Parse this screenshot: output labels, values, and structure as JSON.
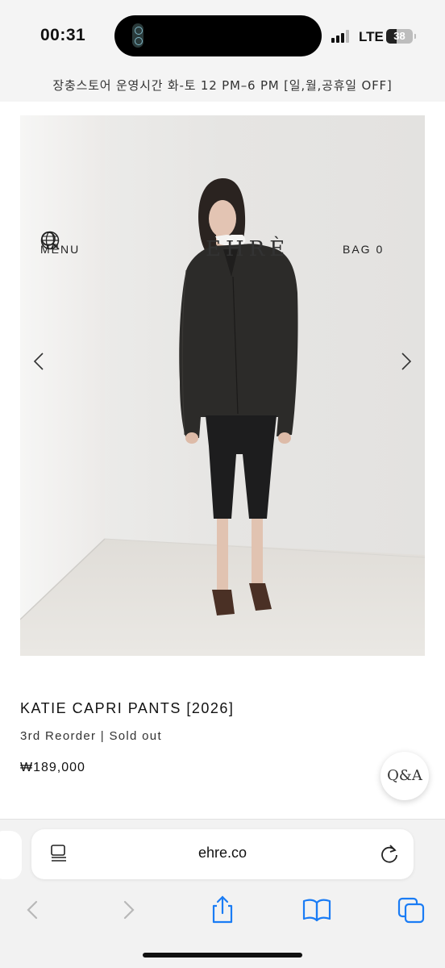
{
  "status_bar": {
    "time": "00:31",
    "network": "LTE",
    "battery": "38",
    "battery_level": 0.38,
    "signal_bars": 3
  },
  "announcement": "장충스토어 운영시간 화-토 12 PM–6 PM [일,월,공휴일 OFF]",
  "header": {
    "menu_label": "MENU",
    "logo": "EHRÈ",
    "bag_label": "BAG 0",
    "icons": [
      "search-icon",
      "globe-icon"
    ]
  },
  "gallery": {
    "prev_icon": "chevron-left-icon",
    "next_icon": "chevron-right-icon"
  },
  "product": {
    "name": "KATIE CAPRI PANTS [2026]",
    "subtitle": "3rd Reorder | Sold out",
    "price": "₩189,000"
  },
  "qa_button": {
    "label": "Q&A"
  },
  "browser": {
    "url": "ehre.co",
    "icons": [
      "reader-icon",
      "reload-icon",
      "back-icon",
      "forward-icon",
      "share-icon",
      "bookmarks-icon",
      "tabs-icon"
    ],
    "accent": "#1a7cf5"
  }
}
